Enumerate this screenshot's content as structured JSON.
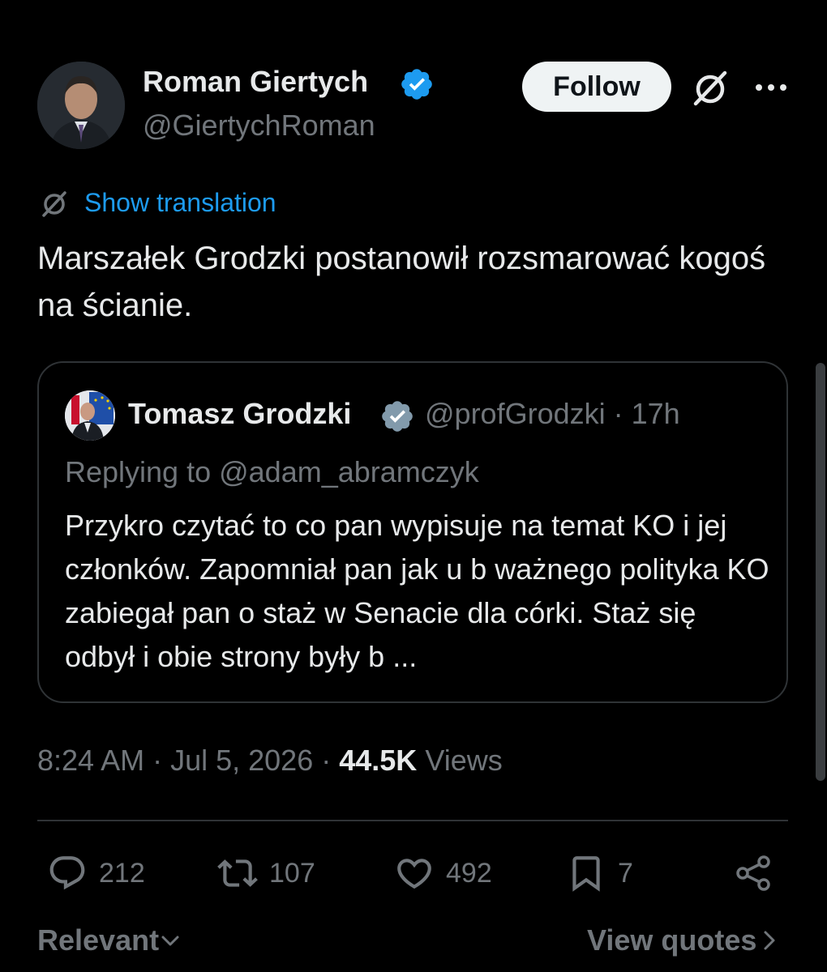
{
  "author": {
    "name": "Roman Giertych",
    "handle": "@GiertychRoman"
  },
  "header": {
    "follow_label": "Follow"
  },
  "translation": {
    "label": "Show translation"
  },
  "tweet": {
    "text": "Marszałek Grodzki postanowił rozsmarować kogoś na ścianie."
  },
  "quote": {
    "name": "Tomasz Grodzki",
    "handle_time": "@profGrodzki · 17h",
    "replying_to": "Replying to @adam_abramczyk",
    "text": "Przykro czytać to co pan wypisuje na temat KO i jej członków. Zapomniał pan jak u b ważnego polityka KO zabiegał pan o staż w Senacie dla córki. Staż się odbył i obie strony były b ..."
  },
  "meta": {
    "time": "8:24 AM",
    "separator": " · ",
    "date": "Jul 5, 2026",
    "views_count": "44.5K",
    "views_label": "Views"
  },
  "actions": {
    "replies": "212",
    "reposts": "107",
    "likes": "492",
    "bookmarks": "7"
  },
  "footer": {
    "sort_label": "Relevant",
    "view_quotes_label": "View quotes"
  },
  "icons": {
    "verified": "verified-badge-icon",
    "grok": "grok-icon",
    "more": "more-icon",
    "translate": "translate-icon",
    "reply": "reply-icon",
    "repost": "repost-icon",
    "like": "heart-icon",
    "bookmark": "bookmark-icon",
    "share": "share-icon"
  },
  "colors": {
    "background": "#000000",
    "text_primary": "#e7e9ea",
    "text_secondary": "#71767b",
    "accent": "#1d9bf0",
    "border": "#2f3336"
  }
}
